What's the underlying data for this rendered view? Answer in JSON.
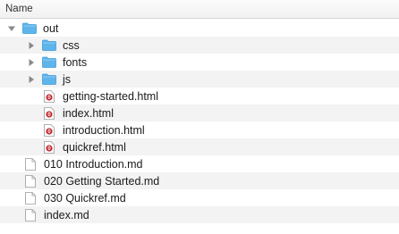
{
  "header": {
    "column_name": "Name"
  },
  "tree": [
    {
      "label": "out",
      "kind": "folder",
      "level": 0,
      "expanded": true
    },
    {
      "label": "css",
      "kind": "folder",
      "level": 1,
      "expanded": false
    },
    {
      "label": "fonts",
      "kind": "folder",
      "level": 1,
      "expanded": false
    },
    {
      "label": "js",
      "kind": "folder",
      "level": 1,
      "expanded": false
    },
    {
      "label": "getting-started.html",
      "kind": "html",
      "level": 1
    },
    {
      "label": "index.html",
      "kind": "html",
      "level": 1
    },
    {
      "label": "introduction.html",
      "kind": "html",
      "level": 1
    },
    {
      "label": "quickref.html",
      "kind": "html",
      "level": 1
    },
    {
      "label": "010 Introduction.md",
      "kind": "document",
      "level": 0
    },
    {
      "label": "020 Getting Started.md",
      "kind": "document",
      "level": 0
    },
    {
      "label": "030 Quickref.md",
      "kind": "document",
      "level": 0
    },
    {
      "label": "index.md",
      "kind": "document",
      "level": 0
    }
  ],
  "colors": {
    "folder": "#5fb5ea",
    "folder_dark": "#3f9bd8",
    "html_badge": "#c1272d",
    "disclosure": "#8a8a8a"
  },
  "icons": {
    "folder": "folder-icon",
    "html": "html-file-icon",
    "document": "document-icon",
    "expanded": "disclosure-triangle-expanded-icon",
    "collapsed": "disclosure-triangle-collapsed-icon"
  }
}
